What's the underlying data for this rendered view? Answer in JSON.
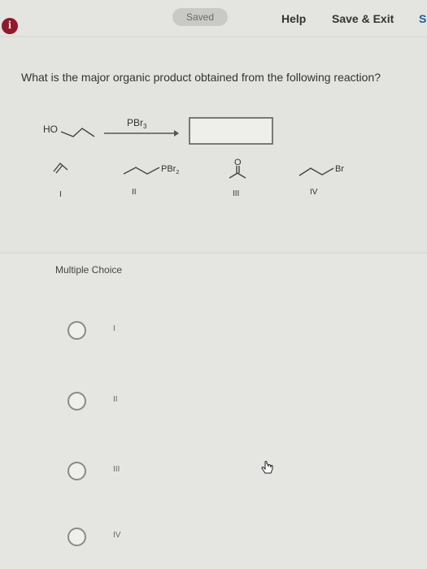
{
  "header": {
    "saved_status": "Saved",
    "help_label": "Help",
    "save_exit_label": "Save & Exit",
    "next_label": "S"
  },
  "question": {
    "prompt": "What is the major organic product obtained from the following reaction?",
    "reactant_label": "HO",
    "reagent_label": "PBr",
    "reagent_subscript": "3",
    "answer_choices_structures": [
      {
        "numeral": "I"
      },
      {
        "numeral": "II",
        "group": "PBr",
        "group_subscript": "2"
      },
      {
        "numeral": "III",
        "atom": "O"
      },
      {
        "numeral": "IV",
        "group": "Br"
      }
    ]
  },
  "multiple_choice": {
    "heading": "Multiple Choice",
    "options": [
      {
        "label": "I"
      },
      {
        "label": "II"
      },
      {
        "label": "III"
      },
      {
        "label": "IV"
      }
    ]
  },
  "colors": {
    "background": "#dcdcd8",
    "info_icon": "#8e1a2c",
    "link_blue": "#1a5fa0"
  },
  "icons": [
    "info-icon",
    "hand-cursor-icon"
  ]
}
